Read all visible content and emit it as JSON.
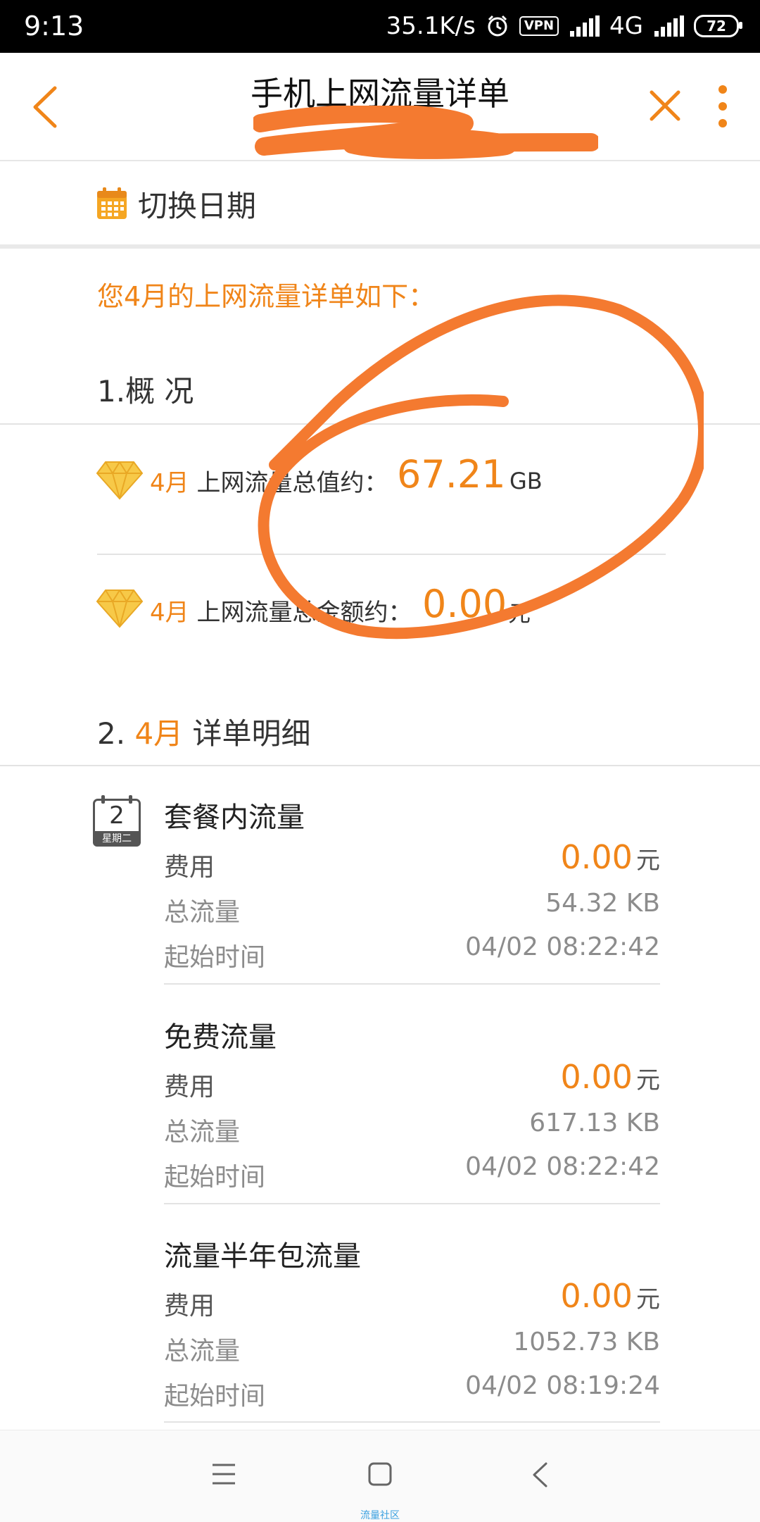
{
  "status_bar": {
    "time": "9:13",
    "speed": "35.1K/s",
    "vpn": "VPN",
    "network": "4G",
    "battery": "72"
  },
  "header": {
    "title": "手机上网流量详单"
  },
  "switch_date": {
    "label": "切换日期"
  },
  "intro": {
    "text": "您4月的上网流量详单如下："
  },
  "overview": {
    "heading": "1.概 况",
    "total_traffic": {
      "month": "4月",
      "label": "上网流量总值约：",
      "value": "67.21",
      "unit": "GB"
    },
    "total_amount": {
      "month": "4月",
      "label": "上网流量总金额约：",
      "value": "0.00",
      "unit": "元"
    }
  },
  "details": {
    "heading_prefix": "2.",
    "heading_month": "4月",
    "heading_suffix": "详单明细",
    "calendar": {
      "day": "2",
      "weekday": "星期二"
    },
    "fee_label": "费用",
    "traffic_label": "总流量",
    "start_label": "起始时间",
    "currency": "元",
    "items": [
      {
        "name": "套餐内流量",
        "fee": "0.00",
        "traffic": "54.32 KB",
        "start": "04/02 08:22:42"
      },
      {
        "name": "免费流量",
        "fee": "0.00",
        "traffic": "617.13 KB",
        "start": "04/02 08:22:42"
      },
      {
        "name": "流量半年包流量",
        "fee": "0.00",
        "traffic": "1052.73 KB",
        "start": "04/02 08:19:24"
      }
    ]
  },
  "watermark": "流量社区",
  "colors": {
    "accent": "#f08519",
    "scribble": "#f47a30",
    "grey_text": "#8c8c8c"
  }
}
